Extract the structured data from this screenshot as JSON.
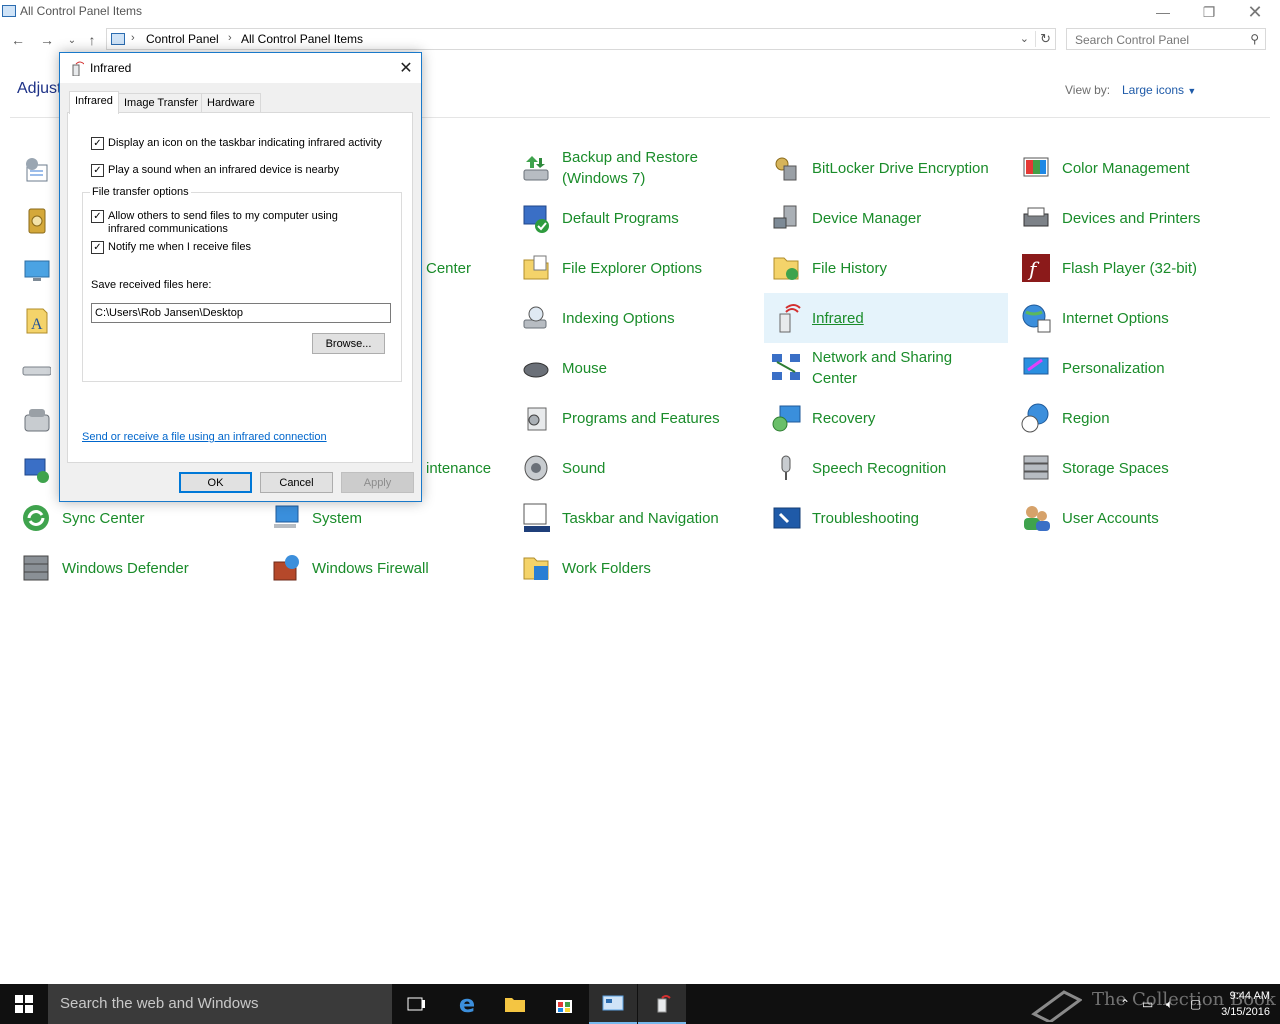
{
  "window": {
    "title": "All Control Panel Items",
    "breadcrumbs": [
      "Control Panel",
      "All Control Panel Items"
    ],
    "search_placeholder": "Search Control Panel",
    "header_text": "Adjust",
    "view_by_label": "View by:",
    "view_by_value": "Large icons"
  },
  "items": [
    {
      "label": "Backup and Restore (Windows 7)",
      "icon": "backup-icon"
    },
    {
      "label": "BitLocker Drive Encryption",
      "icon": "bitlocker-icon"
    },
    {
      "label": "Color Management",
      "icon": "color-management-icon"
    },
    {
      "label": "Default Programs",
      "icon": "default-programs-icon"
    },
    {
      "label": "Device Manager",
      "icon": "device-manager-icon"
    },
    {
      "label": "Devices and Printers",
      "icon": "printer-icon"
    },
    {
      "label": "Center",
      "icon": "center-icon"
    },
    {
      "label": "File Explorer Options",
      "icon": "folder-options-icon"
    },
    {
      "label": "File History",
      "icon": "file-history-icon"
    },
    {
      "label": "Flash Player (32-bit)",
      "icon": "flash-icon"
    },
    {
      "label": "Indexing Options",
      "icon": "indexing-icon"
    },
    {
      "label": "Infrared",
      "icon": "infrared-icon"
    },
    {
      "label": "Internet Options",
      "icon": "internet-options-icon"
    },
    {
      "label": "Mouse",
      "icon": "mouse-icon"
    },
    {
      "label": "Network and Sharing Center",
      "icon": "network-icon"
    },
    {
      "label": "Personalization",
      "icon": "personalization-icon"
    },
    {
      "label": "Programs and Features",
      "icon": "programs-icon"
    },
    {
      "label": "Recovery",
      "icon": "recovery-icon"
    },
    {
      "label": "Region",
      "icon": "region-icon"
    },
    {
      "label": "intenance",
      "icon": "maintenance-icon"
    },
    {
      "label": "Sound",
      "icon": "sound-icon"
    },
    {
      "label": "Speech Recognition",
      "icon": "microphone-icon"
    },
    {
      "label": "Storage Spaces",
      "icon": "storage-icon"
    },
    {
      "label": "Sync Center",
      "icon": "sync-icon"
    },
    {
      "label": "System",
      "icon": "system-icon"
    },
    {
      "label": "Taskbar and Navigation",
      "icon": "taskbar-icon"
    },
    {
      "label": "Troubleshooting",
      "icon": "troubleshooting-icon"
    },
    {
      "label": "User Accounts",
      "icon": "user-accounts-icon"
    },
    {
      "label": "Windows Defender",
      "icon": "defender-icon"
    },
    {
      "label": "Windows Firewall",
      "icon": "firewall-icon"
    },
    {
      "label": "Work Folders",
      "icon": "work-folders-icon"
    }
  ],
  "dialog": {
    "title": "Infrared",
    "tabs": [
      "Infrared",
      "Image Transfer",
      "Hardware"
    ],
    "options": [
      {
        "label": "Display an icon on the taskbar indicating infrared activity",
        "checked": true
      },
      {
        "label": "Play a sound when an infrared device is nearby",
        "checked": true
      }
    ],
    "group_title": "File transfer options",
    "group_options": [
      {
        "label": "Allow others to send files to my computer using infrared communications",
        "checked": true
      },
      {
        "label": "Notify me when I receive files",
        "checked": true
      }
    ],
    "save_label": "Save received files here:",
    "save_path": "C:\\Users\\Rob Jansen\\Desktop",
    "browse_label": "Browse...",
    "link_text": "Send or receive a file using an infrared connection",
    "ok_label": "OK",
    "cancel_label": "Cancel",
    "apply_label": "Apply"
  },
  "taskbar": {
    "search_placeholder": "Search the web and Windows",
    "time": "9:44 AM",
    "date": "3/15/2016",
    "watermark": "The Collection Book"
  },
  "colors": {
    "link_green": "#1a8c2a",
    "accent": "#0078d7",
    "taskbar": "#101010"
  }
}
